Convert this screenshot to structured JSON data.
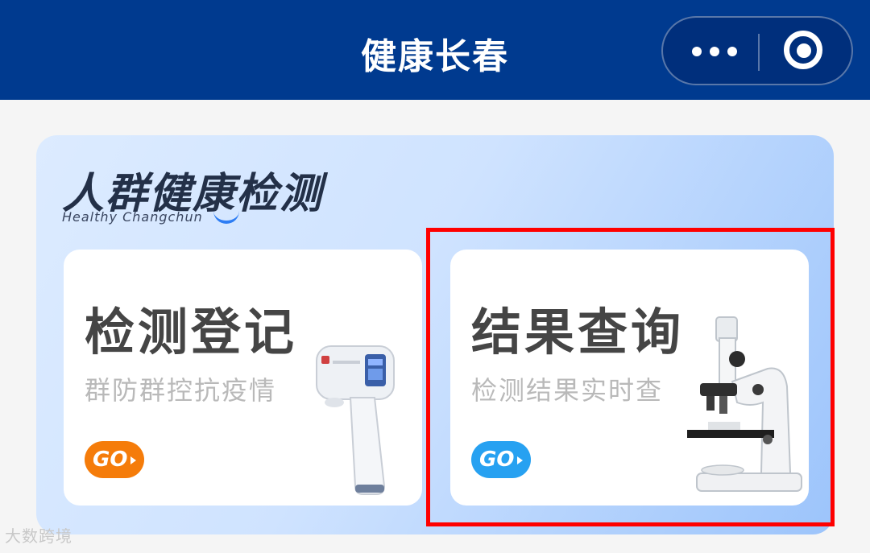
{
  "header": {
    "title": "健康长春",
    "more_icon": "more-dots-icon",
    "close_icon": "target-close-icon"
  },
  "banner": {
    "title": "人群健康检测",
    "subtitle": "Healthy Changchun"
  },
  "cards": [
    {
      "title": "检测登记",
      "subtitle": "群防群控抗疫情",
      "go_label": "GO",
      "illustration": "thermometer-gun",
      "accent": "#f57c0a"
    },
    {
      "title": "结果查询",
      "subtitle": "检测结果实时查",
      "go_label": "GO",
      "illustration": "microscope",
      "accent": "#27a1f1"
    }
  ],
  "watermark": "大数跨境",
  "colors": {
    "header_bg": "#003a8f",
    "highlight": "#ff0000"
  }
}
